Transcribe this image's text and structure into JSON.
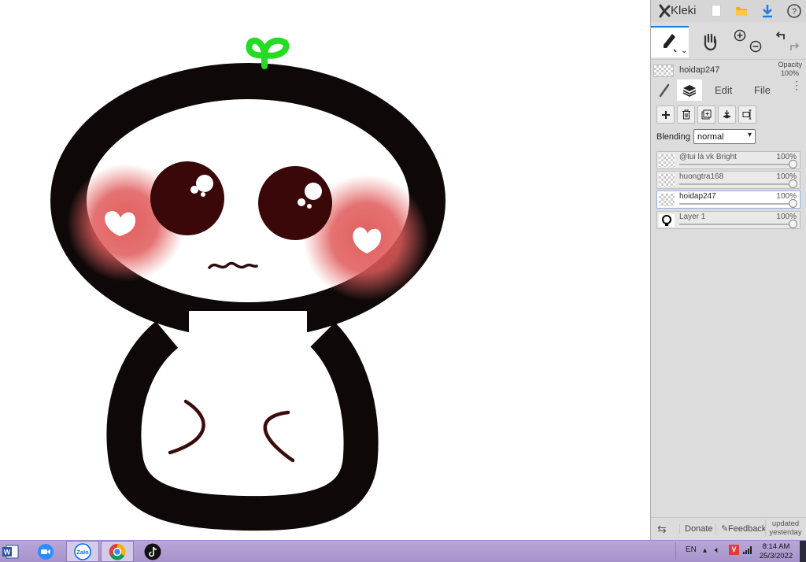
{
  "app": {
    "name": "Kleki"
  },
  "layer_bar": {
    "current_layer": "hoidap247",
    "opacity_label": "Opacity",
    "opacity_value": "100%"
  },
  "tabs": {
    "edit": "Edit",
    "file": "File"
  },
  "blending": {
    "label": "Blending",
    "value": "normal"
  },
  "layers": [
    {
      "name": "@tui là vk Bright",
      "opacity": "100%"
    },
    {
      "name": "huongtra168",
      "opacity": "100%"
    },
    {
      "name": "hoidap247",
      "opacity": "100%"
    },
    {
      "name": "Layer 1",
      "opacity": "100%"
    }
  ],
  "footer": {
    "donate": "Donate",
    "feedback": "Feedback",
    "updated_line1": "updated",
    "updated_line2": "yesterday"
  },
  "taskbar": {
    "apps": [
      "Word",
      "Zoom",
      "Zalo",
      "Chrome",
      "TikTok"
    ],
    "zalo_label": "Zalo",
    "lang": "EN",
    "time": "8:14 AM",
    "date": "25/3/2022"
  },
  "colors": {
    "accent": "#1f7fe0",
    "panel_bg": "#dcdcdc",
    "taskbar_bg": "#a998cf",
    "folder": "#f0b020",
    "sprout": "#22dd22"
  }
}
